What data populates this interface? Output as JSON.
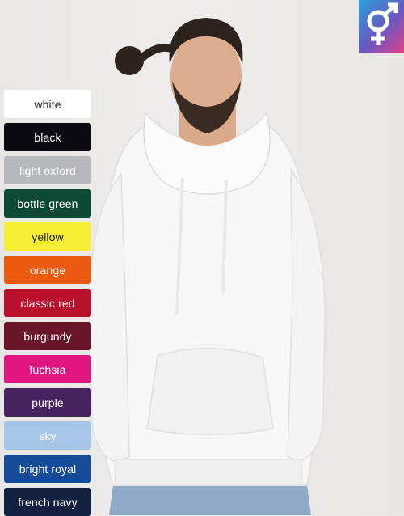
{
  "badge": {
    "icon": "unisex-gender-icon"
  },
  "photo": {
    "subject": "model-wearing-white-hoodie"
  },
  "colors": [
    {
      "label": "white",
      "bg": "#ffffff",
      "fg": "#222222"
    },
    {
      "label": "black",
      "bg": "#0b0a10",
      "fg": "#ffffff"
    },
    {
      "label": "light oxford",
      "bg": "#b7b8bb",
      "fg": "#ffffff"
    },
    {
      "label": "bottle green",
      "bg": "#0d4a36",
      "fg": "#ffffff"
    },
    {
      "label": "yellow",
      "bg": "#f6ee35",
      "fg": "#222222"
    },
    {
      "label": "orange",
      "bg": "#ec5a12",
      "fg": "#ffffff"
    },
    {
      "label": "classic red",
      "bg": "#b8102b",
      "fg": "#ffffff"
    },
    {
      "label": "burgundy",
      "bg": "#6a1528",
      "fg": "#ffffff"
    },
    {
      "label": "fuchsia",
      "bg": "#e0157f",
      "fg": "#ffffff"
    },
    {
      "label": "purple",
      "bg": "#46235f",
      "fg": "#ffffff"
    },
    {
      "label": "sky",
      "bg": "#a7c6e7",
      "fg": "#ffffff"
    },
    {
      "label": "bright royal",
      "bg": "#164b9a",
      "fg": "#ffffff"
    },
    {
      "label": "french navy",
      "bg": "#14203f",
      "fg": "#ffffff"
    }
  ]
}
